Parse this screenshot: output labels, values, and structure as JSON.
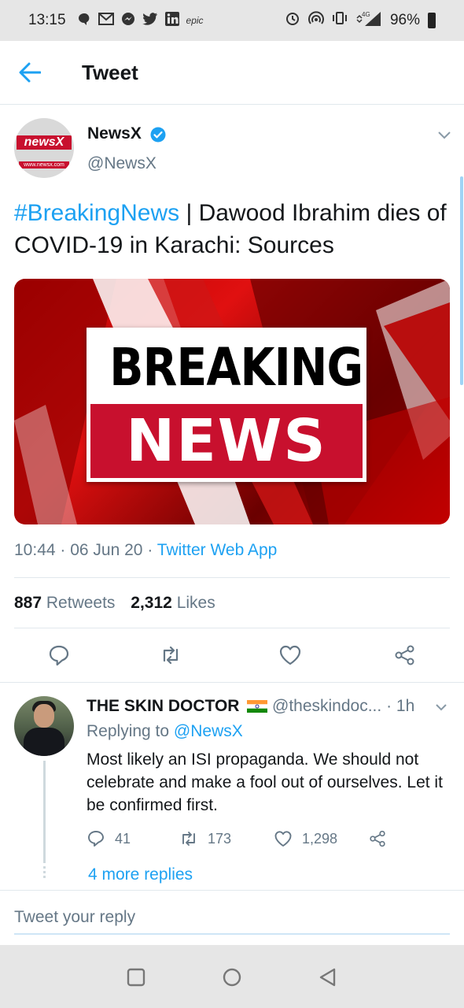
{
  "status_bar": {
    "time": "13:15",
    "notification_icons": [
      "chat-bubble-icon",
      "gmail-icon",
      "messenger-icon",
      "twitter-icon",
      "linkedin-icon",
      "epic-icon"
    ],
    "system_icons": [
      "alarm-icon",
      "hotspot-icon",
      "vibrate-icon",
      "4g-signal-icon"
    ],
    "network": "4G",
    "battery": "96%"
  },
  "app_bar": {
    "title": "Tweet"
  },
  "tweet": {
    "author_name": "NewsX",
    "author_handle": "@NewsX",
    "avatar_text": "newsX",
    "avatar_url_text": "www.newsx.com",
    "hashtag": "#BreakingNews",
    "text": " | Dawood Ibrahim dies of COVID-19 in Karachi: Sources",
    "media": {
      "line1": "BREAKING",
      "line2": "NEWS"
    },
    "time": "10:44",
    "date": "06 Jun 20",
    "source": "Twitter Web App",
    "retweets_count": "887",
    "retweets_label": "Retweets",
    "likes_count": "2,312",
    "likes_label": "Likes"
  },
  "reply": {
    "name": "THE SKIN DOCTOR",
    "handle": "@theskindoc...",
    "time": "· 1h",
    "replying_prefix": "Replying to ",
    "replying_to": "@NewsX",
    "text": "Most likely an ISI propaganda. We should not celebrate and make a fool out of ourselves. Let it be confirmed first.",
    "reply_count": "41",
    "retweet_count": "173",
    "like_count": "1,298"
  },
  "more_replies": "4 more replies",
  "composer": {
    "placeholder": "Tweet your reply"
  },
  "colors": {
    "accent": "#1da1f2",
    "secondary_text": "#657786",
    "brand_red": "#c8102e"
  }
}
